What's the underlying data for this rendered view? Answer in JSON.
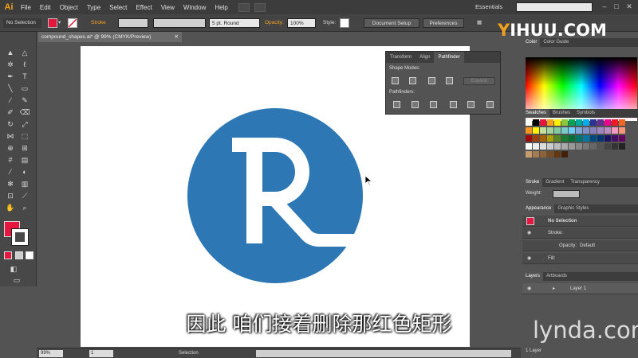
{
  "app": {
    "logo": "Ai",
    "document_tab": "compound_shapes.ai* @ 99% (CMYK/Preview)"
  },
  "menu": [
    "File",
    "Edit",
    "Object",
    "Type",
    "Select",
    "Effect",
    "View",
    "Window",
    "Help"
  ],
  "workspace": "Essentials",
  "control_bar": {
    "selection": "No Selection",
    "stroke_label": "Stroke",
    "brush": "5 pt. Round",
    "opacity_label": "Opacity:",
    "opacity_value": "100%",
    "style_label": "Style:",
    "document_setup": "Document Setup",
    "preferences": "Preferences"
  },
  "pathfinder_panel": {
    "tabs": [
      "Transform",
      "Align",
      "Pathfinder"
    ],
    "active_tab": "Pathfinder",
    "shape_modes_label": "Shape Modes:",
    "pathfinders_label": "Pathfinders:",
    "expand_label": "Expand"
  },
  "right_panels": {
    "color_tabs": [
      "Color",
      "Color Guide"
    ],
    "swatch_tabs": [
      "Swatches",
      "Brushes",
      "Symbols"
    ],
    "stroke_tabs": [
      "Stroke",
      "Gradient",
      "Transparency"
    ],
    "weight_label": "Weight:",
    "appearance_tabs": [
      "Appearance",
      "Graphic Styles"
    ],
    "appearance_title": "No Selection",
    "appearance_stroke": "Stroke:",
    "appearance_opacity": "Opacity:",
    "appearance_opacity_value": "Default",
    "appearance_fill": "Fill:",
    "layers_tabs": [
      "Layers",
      "Artboards"
    ],
    "layer_name": "Layer 1",
    "layer_count": "1 Layer"
  },
  "status_bar": {
    "zoom": "99%",
    "artboard": "1",
    "tool": "Selection"
  },
  "subtitle": "因此  咱们接着删除那红色矩形",
  "watermarks": {
    "site": "YIHUU.COM",
    "brand": "lynda.com"
  },
  "colors": {
    "fill": "#e5173f",
    "circle": "#2d78b4",
    "accent_orange": "#f3a024"
  }
}
